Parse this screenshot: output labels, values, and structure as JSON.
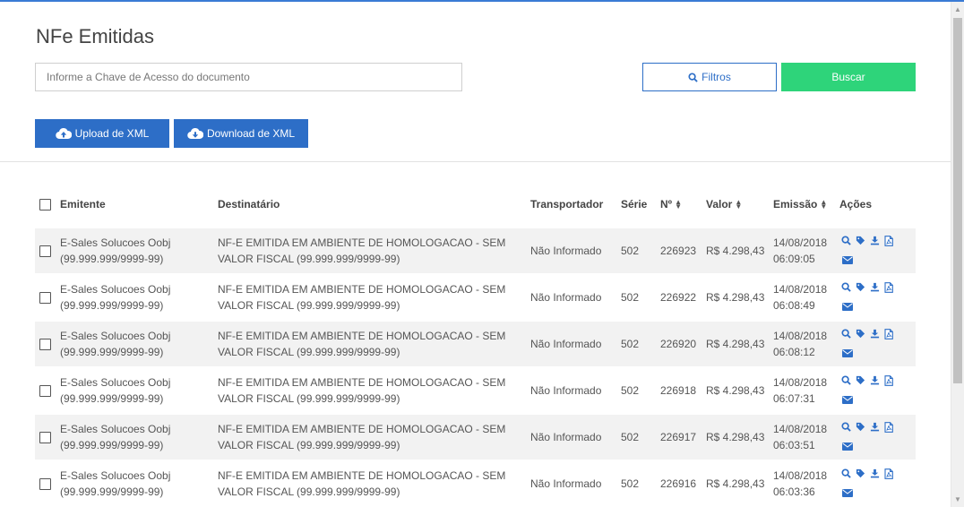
{
  "page": {
    "title": "NFe Emitidas"
  },
  "search": {
    "placeholder": "Informe a Chave de Acesso do documento",
    "value": ""
  },
  "toolbar": {
    "filtros_label": "Filtros",
    "buscar_label": "Buscar",
    "upload_label": "Upload de XML",
    "download_label": "Download de XML"
  },
  "colors": {
    "primary": "#2d6ec7",
    "success": "#2ed47a",
    "row_stripe": "#f2f2f2"
  },
  "table": {
    "columns": {
      "emitente": "Emitente",
      "destinatario": "Destinatário",
      "transportador": "Transportador",
      "serie": "Série",
      "numero": "Nº",
      "valor": "Valor",
      "emissao": "Emissão",
      "acoes": "Ações"
    },
    "action_icons": [
      "search-icon",
      "tag-icon",
      "download-icon",
      "pdf-icon",
      "envelope-icon"
    ],
    "rows": [
      {
        "emitente_name": "E-Sales Solucoes Oobj",
        "emitente_doc": "(99.999.999/9999-99)",
        "dest_line1": "NF-E EMITIDA EM AMBIENTE DE HOMOLOGACAO - SEM",
        "dest_line2": "VALOR FISCAL (99.999.999/9999-99)",
        "transportador": "Não Informado",
        "serie": "502",
        "numero": "226923",
        "valor": "R$ 4.298,43",
        "data": "14/08/2018",
        "hora": "06:09:05"
      },
      {
        "emitente_name": "E-Sales Solucoes Oobj",
        "emitente_doc": "(99.999.999/9999-99)",
        "dest_line1": "NF-E EMITIDA EM AMBIENTE DE HOMOLOGACAO - SEM",
        "dest_line2": "VALOR FISCAL (99.999.999/9999-99)",
        "transportador": "Não Informado",
        "serie": "502",
        "numero": "226922",
        "valor": "R$ 4.298,43",
        "data": "14/08/2018",
        "hora": "06:08:49"
      },
      {
        "emitente_name": "E-Sales Solucoes Oobj",
        "emitente_doc": "(99.999.999/9999-99)",
        "dest_line1": "NF-E EMITIDA EM AMBIENTE DE HOMOLOGACAO - SEM",
        "dest_line2": "VALOR FISCAL (99.999.999/9999-99)",
        "transportador": "Não Informado",
        "serie": "502",
        "numero": "226920",
        "valor": "R$ 4.298,43",
        "data": "14/08/2018",
        "hora": "06:08:12"
      },
      {
        "emitente_name": "E-Sales Solucoes Oobj",
        "emitente_doc": "(99.999.999/9999-99)",
        "dest_line1": "NF-E EMITIDA EM AMBIENTE DE HOMOLOGACAO - SEM",
        "dest_line2": "VALOR FISCAL (99.999.999/9999-99)",
        "transportador": "Não Informado",
        "serie": "502",
        "numero": "226918",
        "valor": "R$ 4.298,43",
        "data": "14/08/2018",
        "hora": "06:07:31"
      },
      {
        "emitente_name": "E-Sales Solucoes Oobj",
        "emitente_doc": "(99.999.999/9999-99)",
        "dest_line1": "NF-E EMITIDA EM AMBIENTE DE HOMOLOGACAO - SEM",
        "dest_line2": "VALOR FISCAL (99.999.999/9999-99)",
        "transportador": "Não Informado",
        "serie": "502",
        "numero": "226917",
        "valor": "R$ 4.298,43",
        "data": "14/08/2018",
        "hora": "06:03:51"
      },
      {
        "emitente_name": "E-Sales Solucoes Oobj",
        "emitente_doc": "(99.999.999/9999-99)",
        "dest_line1": "NF-E EMITIDA EM AMBIENTE DE HOMOLOGACAO - SEM",
        "dest_line2": "VALOR FISCAL (99.999.999/9999-99)",
        "transportador": "Não Informado",
        "serie": "502",
        "numero": "226916",
        "valor": "R$ 4.298,43",
        "data": "14/08/2018",
        "hora": "06:03:36"
      }
    ]
  }
}
